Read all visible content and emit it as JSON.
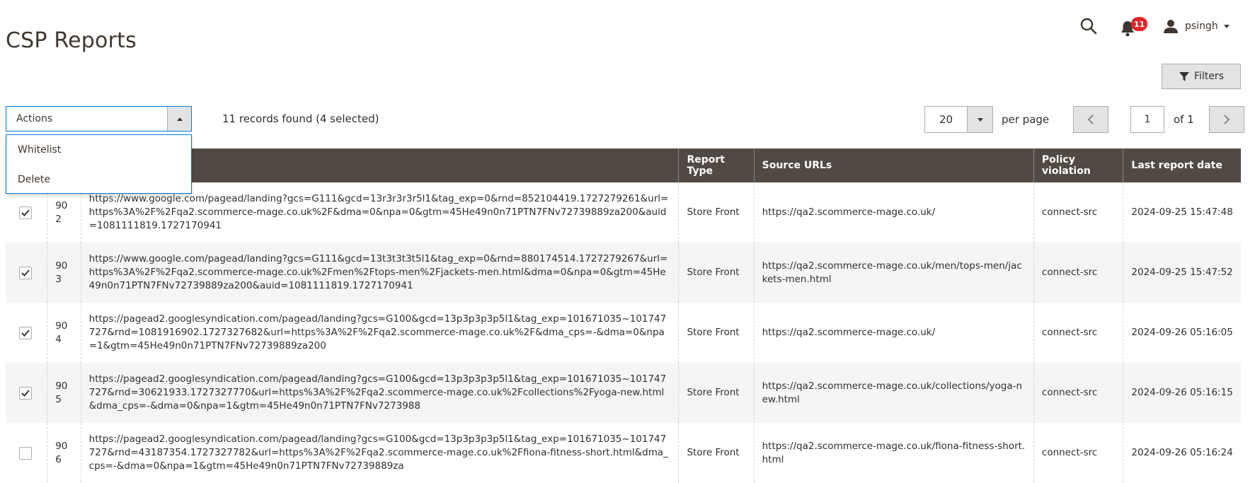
{
  "page": {
    "title": "CSP Reports"
  },
  "header": {
    "user_name": "psingh",
    "notification_count": "11"
  },
  "toolbar": {
    "filters_label": "Filters",
    "actions_label": "Actions",
    "actions_menu": [
      "Whitelist",
      "Delete"
    ],
    "records_info": "11 records found (4 selected)",
    "per_page_value": "20",
    "per_page_label": "per page",
    "current_page": "1",
    "page_of": "of 1"
  },
  "columns": [
    "Report Type",
    "Source URLs",
    "Policy violation",
    "Last report date"
  ],
  "rows": [
    {
      "checked": true,
      "id": "902",
      "blocked": "https://www.google.com/pagead/landing?gcs=G111&gcd=13r3r3r3r5l1&tag_exp=0&rnd=852104419.1727279261&url=https%3A%2F%2Fqa2.scommerce-mage.co.uk%2F&dma=0&npa=0&gtm=45He49n0n71PTN7FNv72739889za200&auid=1081111819.1727170941",
      "type": "Store Front",
      "source": "https://qa2.scommerce-mage.co.uk/",
      "policy": "connect-src",
      "date": "2024-09-25 15:47:48"
    },
    {
      "checked": true,
      "id": "903",
      "blocked": "https://www.google.com/pagead/landing?gcs=G111&gcd=13t3t3t3t5l1&tag_exp=0&rnd=880174514.1727279267&url=https%3A%2F%2Fqa2.scommerce-mage.co.uk%2Fmen%2Ftops-men%2Fjackets-men.html&dma=0&npa=0&gtm=45He49n0n71PTN7FNv72739889za200&auid=1081111819.1727170941",
      "type": "Store Front",
      "source": "https://qa2.scommerce-mage.co.uk/men/tops-men/jackets-men.html",
      "policy": "connect-src",
      "date": "2024-09-25 15:47:52"
    },
    {
      "checked": true,
      "id": "904",
      "blocked": "https://pagead2.googlesyndication.com/pagead/landing?gcs=G100&gcd=13p3p3p3p5l1&tag_exp=101671035~101747727&rnd=1081916902.1727327682&url=https%3A%2F%2Fqa2.scommerce-mage.co.uk%2F&dma_cps=-&dma=0&npa=1&gtm=45He49n0n71PTN7FNv72739889za200",
      "type": "Store Front",
      "source": "https://qa2.scommerce-mage.co.uk/",
      "policy": "connect-src",
      "date": "2024-09-26 05:16:05"
    },
    {
      "checked": true,
      "id": "905",
      "blocked": "https://pagead2.googlesyndication.com/pagead/landing?gcs=G100&gcd=13p3p3p3p5l1&tag_exp=101671035~101747727&rnd=30621933.1727327770&url=https%3A%2F%2Fqa2.scommerce-mage.co.uk%2Fcollections%2Fyoga-new.html&dma_cps=-&dma=0&npa=1&gtm=45He49n0n71PTN7FNv7273988",
      "type": "Store Front",
      "source": "https://qa2.scommerce-mage.co.uk/collections/yoga-new.html",
      "policy": "connect-src",
      "date": "2024-09-26 05:16:15"
    },
    {
      "checked": false,
      "id": "906",
      "blocked": "https://pagead2.googlesyndication.com/pagead/landing?gcs=G100&gcd=13p3p3p3p5l1&tag_exp=101671035~101747727&rnd=43187354.1727327782&url=https%3A%2F%2Fqa2.scommerce-mage.co.uk%2Ffiona-fitness-short.html&dma_cps=-&dma=0&npa=1&gtm=45He49n0n71PTN7FNv72739889za",
      "type": "Store Front",
      "source": "https://qa2.scommerce-mage.co.uk/fiona-fitness-short.html",
      "policy": "connect-src",
      "date": "2024-09-26 05:16:24"
    }
  ],
  "icons": {
    "search": "search-icon",
    "bell": "bell-icon",
    "user": "user-icon",
    "filter": "filter-icon",
    "check": "check-icon"
  },
  "colors": {
    "header_bg": "#514943",
    "badge": "#e22626",
    "focus_border": "#007bdb"
  }
}
